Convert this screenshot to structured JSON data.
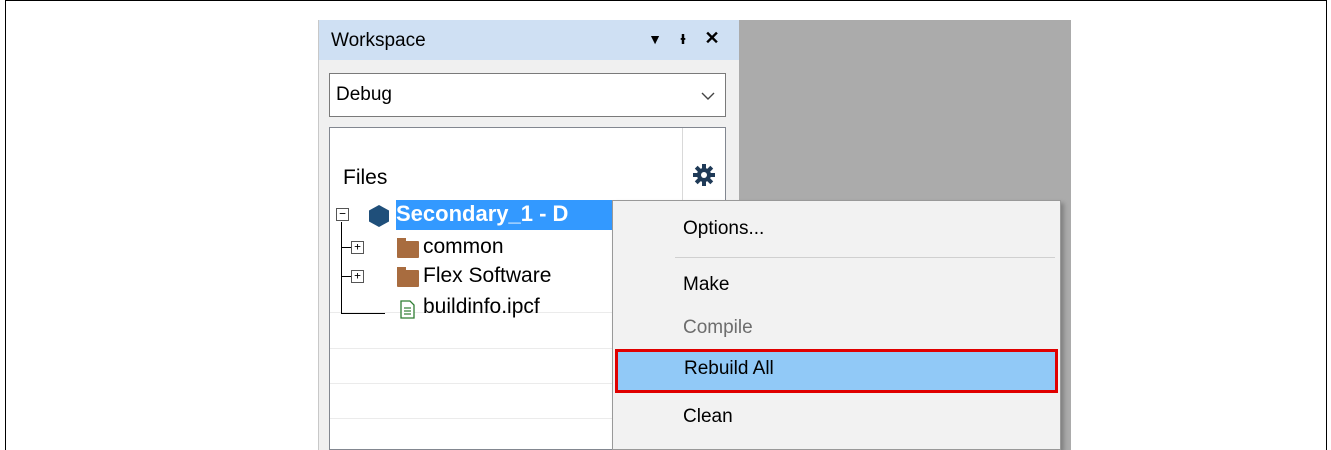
{
  "workspace": {
    "title": "Workspace",
    "controls": {
      "dropdown": "▼",
      "pin": "ᵻ",
      "close": "✕"
    },
    "configuration": {
      "selected": "Debug"
    },
    "tree": {
      "header": "Files",
      "root": {
        "label": "Secondary_1 - D",
        "checked": "✔"
      },
      "items": [
        {
          "label": "common",
          "type": "folder",
          "expander": "+"
        },
        {
          "label": "Flex Software",
          "type": "folder",
          "expander": "+"
        },
        {
          "label": "buildinfo.ipcf",
          "type": "file"
        }
      ],
      "root_expander": "−"
    }
  },
  "context_menu": {
    "items": [
      {
        "label": "Options...",
        "enabled": true
      },
      {
        "label": "Make",
        "enabled": true
      },
      {
        "label": "Compile",
        "enabled": false
      },
      {
        "label": "Rebuild All",
        "enabled": true,
        "highlighted": true
      },
      {
        "label": "Clean",
        "enabled": true
      }
    ]
  },
  "colors": {
    "title_bar": "#cfe0f3",
    "selection": "#3399ff",
    "menu_highlight": "#91c9f7",
    "callout_border": "#e00000",
    "project_icon": "#1f4f7a",
    "folder": "#a86c3f",
    "file_icon": "#2e7d32"
  }
}
